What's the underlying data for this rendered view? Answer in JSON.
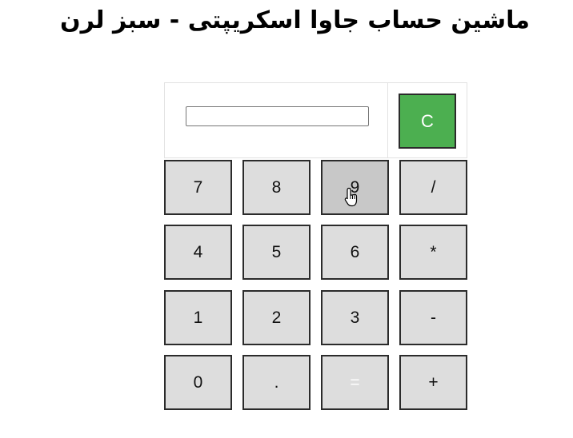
{
  "title": "ماشین حساب جاوا اسکریپتی - سبز لرن",
  "display": {
    "value": "",
    "placeholder": ""
  },
  "clear_label": "C",
  "keys": [
    [
      "7",
      "8",
      "9",
      "/"
    ],
    [
      "4",
      "5",
      "6",
      "*"
    ],
    [
      "1",
      "2",
      "3",
      "-"
    ],
    [
      "0",
      ".",
      "=",
      "+"
    ]
  ],
  "colors": {
    "clear_button": "#4caf50",
    "key_background": "#dddddd",
    "key_hover": "#c8c8c8",
    "key_border": "#2b2b2b"
  },
  "hovered_key": "9",
  "cursor_icon": "hand-pointer-icon"
}
